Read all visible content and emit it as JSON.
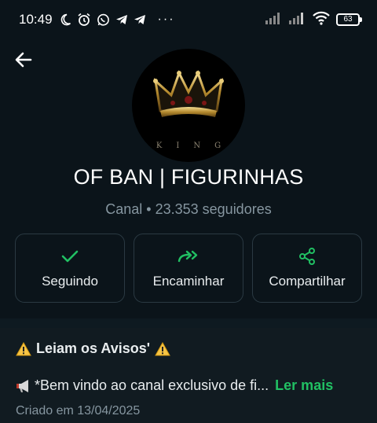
{
  "status_bar": {
    "time": "10:49",
    "battery": "63",
    "icons": [
      "moon-icon",
      "alarm-icon",
      "whatsapp-icon",
      "telegram-icon",
      "telegram-icon",
      "more-dots-icon"
    ],
    "dots": "···"
  },
  "avatar": {
    "caption": "KING"
  },
  "channel": {
    "name": "OF BAN | FIGURINHAS",
    "meta": "Canal • 23.353 seguidores"
  },
  "actions": [
    {
      "label": "Seguindo",
      "icon": "check-icon"
    },
    {
      "label": "Encaminhar",
      "icon": "forward-icon"
    },
    {
      "label": "Compartilhar",
      "icon": "share-icon"
    }
  ],
  "description": {
    "notice": "Leiam os Avisos'",
    "preview": "*Bem vindo ao canal exclusivo de fi...",
    "read_more": "Ler mais",
    "created": "Criado em 13/04/2025"
  },
  "colors": {
    "background": "#0b141a",
    "accent": "#21c063",
    "secondary_text": "#8696a0",
    "border": "#2a3942"
  }
}
